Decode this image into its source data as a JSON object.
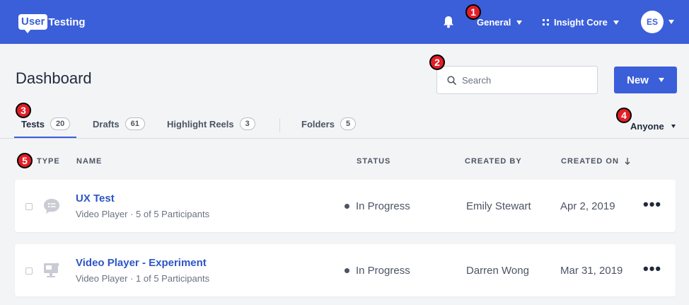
{
  "brand": {
    "logo_user": "User",
    "logo_testing": "Testing"
  },
  "topbar": {
    "workspace": "General",
    "account": "Insight Core",
    "avatar_initials": "ES"
  },
  "page": {
    "title": "Dashboard"
  },
  "search": {
    "placeholder": "Search"
  },
  "new_button": {
    "label": "New"
  },
  "tabs": [
    {
      "label": "Tests",
      "count": "20"
    },
    {
      "label": "Drafts",
      "count": "61"
    },
    {
      "label": "Highlight Reels",
      "count": "3"
    },
    {
      "label": "Folders",
      "count": "5"
    }
  ],
  "filter": {
    "owner": "Anyone"
  },
  "columns": {
    "type": "TYPE",
    "name": "NAME",
    "status": "STATUS",
    "created_by": "CREATED BY",
    "created_on": "CREATED ON"
  },
  "rows": [
    {
      "title": "UX Test",
      "subtitle": "Video Player · 5 of 5 Participants",
      "status": "In Progress",
      "creator": "Emily Stewart",
      "date": "Apr 2, 2019",
      "icon": "chat-bubble-icon"
    },
    {
      "title": "Video Player - Experiment",
      "subtitle": "Video Player · 1 of 5 Participants",
      "status": "In Progress",
      "creator": "Darren Wong",
      "date": "Mar 31, 2019",
      "icon": "monitor-icon"
    }
  ],
  "annotations": [
    "1",
    "2",
    "3",
    "4",
    "5"
  ],
  "colors": {
    "brand_blue": "#3b5fd9",
    "annotation_red": "#e21e26",
    "link_blue": "#2d55c7"
  }
}
